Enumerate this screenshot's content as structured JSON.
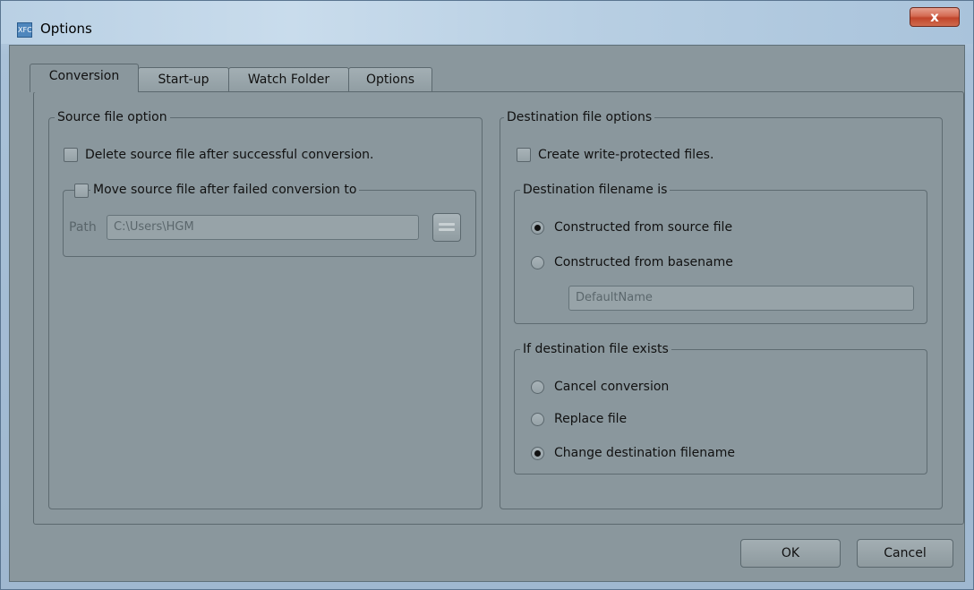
{
  "window": {
    "title": "Options",
    "app_icon_text": "XFC",
    "close_label": "x"
  },
  "tabs": [
    {
      "label": "Conversion",
      "active": true
    },
    {
      "label": "Start-up",
      "active": false
    },
    {
      "label": "Watch Folder",
      "active": false
    },
    {
      "label": "Options",
      "active": false
    }
  ],
  "source": {
    "legend": "Source file option",
    "delete_label": "Delete source file after successful conversion.",
    "delete_checked": false,
    "move": {
      "legend": "Move source file after failed conversion to",
      "checked": false,
      "path_label": "Path",
      "path_value": "C:\\Users\\HGM"
    }
  },
  "destination": {
    "legend": "Destination file options",
    "write_protect_label": "Create write-protected files.",
    "write_protect_checked": false,
    "filename": {
      "legend": "Destination filename is",
      "options": [
        {
          "label": "Constructed from source file",
          "selected": true
        },
        {
          "label": "Constructed from basename",
          "selected": false
        }
      ],
      "basename_value": "DefaultName"
    },
    "exists": {
      "legend": "If destination file exists",
      "options": [
        {
          "label": "Cancel conversion",
          "selected": false
        },
        {
          "label": "Replace file",
          "selected": false
        },
        {
          "label": "Change destination filename",
          "selected": true
        }
      ]
    }
  },
  "buttons": {
    "ok": "OK",
    "cancel": "Cancel"
  }
}
